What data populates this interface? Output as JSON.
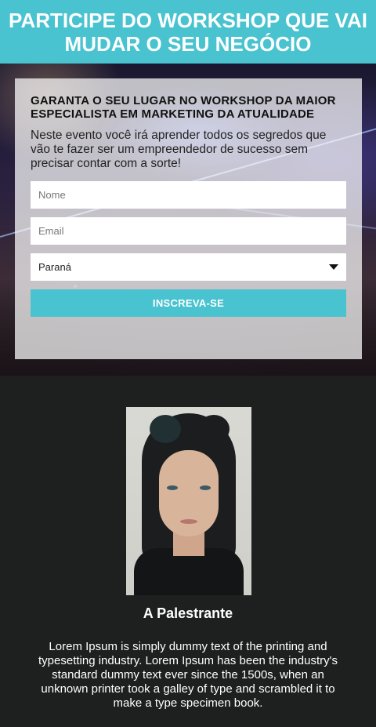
{
  "banner": {
    "title": "PARTICIPE DO WORKSHOP QUE VAI MUDAR O SEU NEGÓCIO"
  },
  "form": {
    "heading": "GARANTA O SEU LUGAR NO WORKSHOP DA MAIOR ESPECIALISTA EM MARKETING DA ATUALIDADE",
    "description": "Neste evento você irá aprender todos os segredos que vão te fazer ser um empreendedor de sucesso sem precisar contar com a sorte!",
    "name_placeholder": "Nome",
    "email_placeholder": "Email",
    "state_selected": "Paraná",
    "submit_label": "INSCREVA-SE"
  },
  "speaker": {
    "title": "A Palestrante",
    "bio": "Lorem Ipsum is simply dummy text of the printing and typesetting industry. Lorem Ipsum has been the industry's standard dummy text ever since the 1500s, when an unknown printer took a galley of type and scrambled it to make a type specimen book."
  },
  "colors": {
    "accent": "#49c3cf",
    "dark_bg": "#1e1f1f"
  }
}
